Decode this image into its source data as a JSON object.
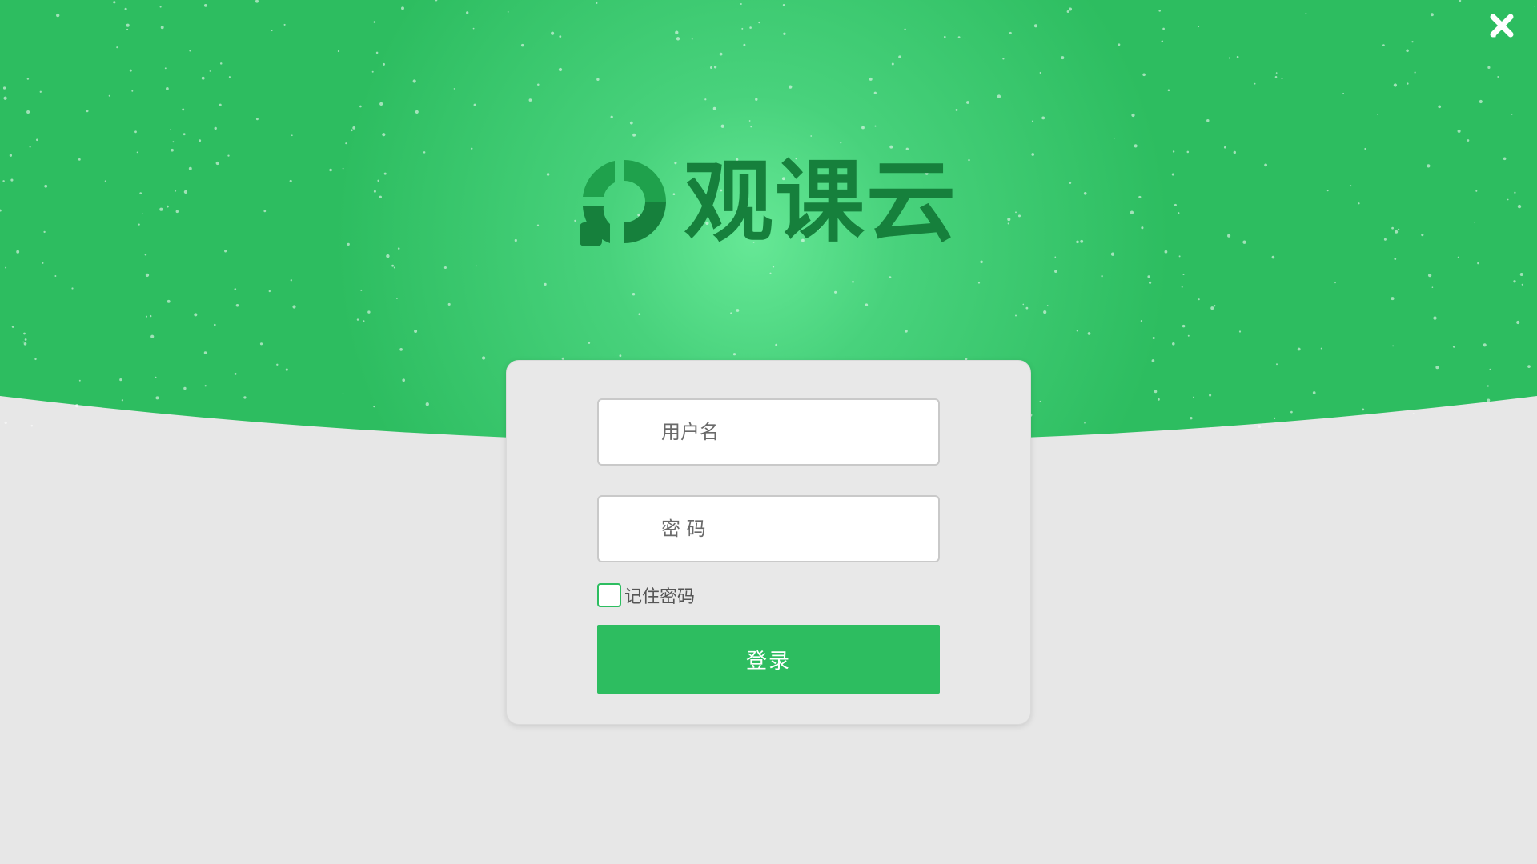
{
  "window": {
    "close_icon": "close-icon"
  },
  "brand": {
    "name": "观课云",
    "logo_icon": "guanke-logo-icon"
  },
  "login": {
    "username": {
      "placeholder": "用户名",
      "value": ""
    },
    "password": {
      "placeholder": "密 码",
      "value": ""
    },
    "remember": {
      "label": "记住密码",
      "checked": false
    },
    "submit_label": "登录"
  },
  "colors": {
    "brand_green": "#2dbd60",
    "brand_dark_green": "#16803c",
    "hero_light_green": "#5ee38f",
    "background_gray": "#e7e7e7"
  }
}
